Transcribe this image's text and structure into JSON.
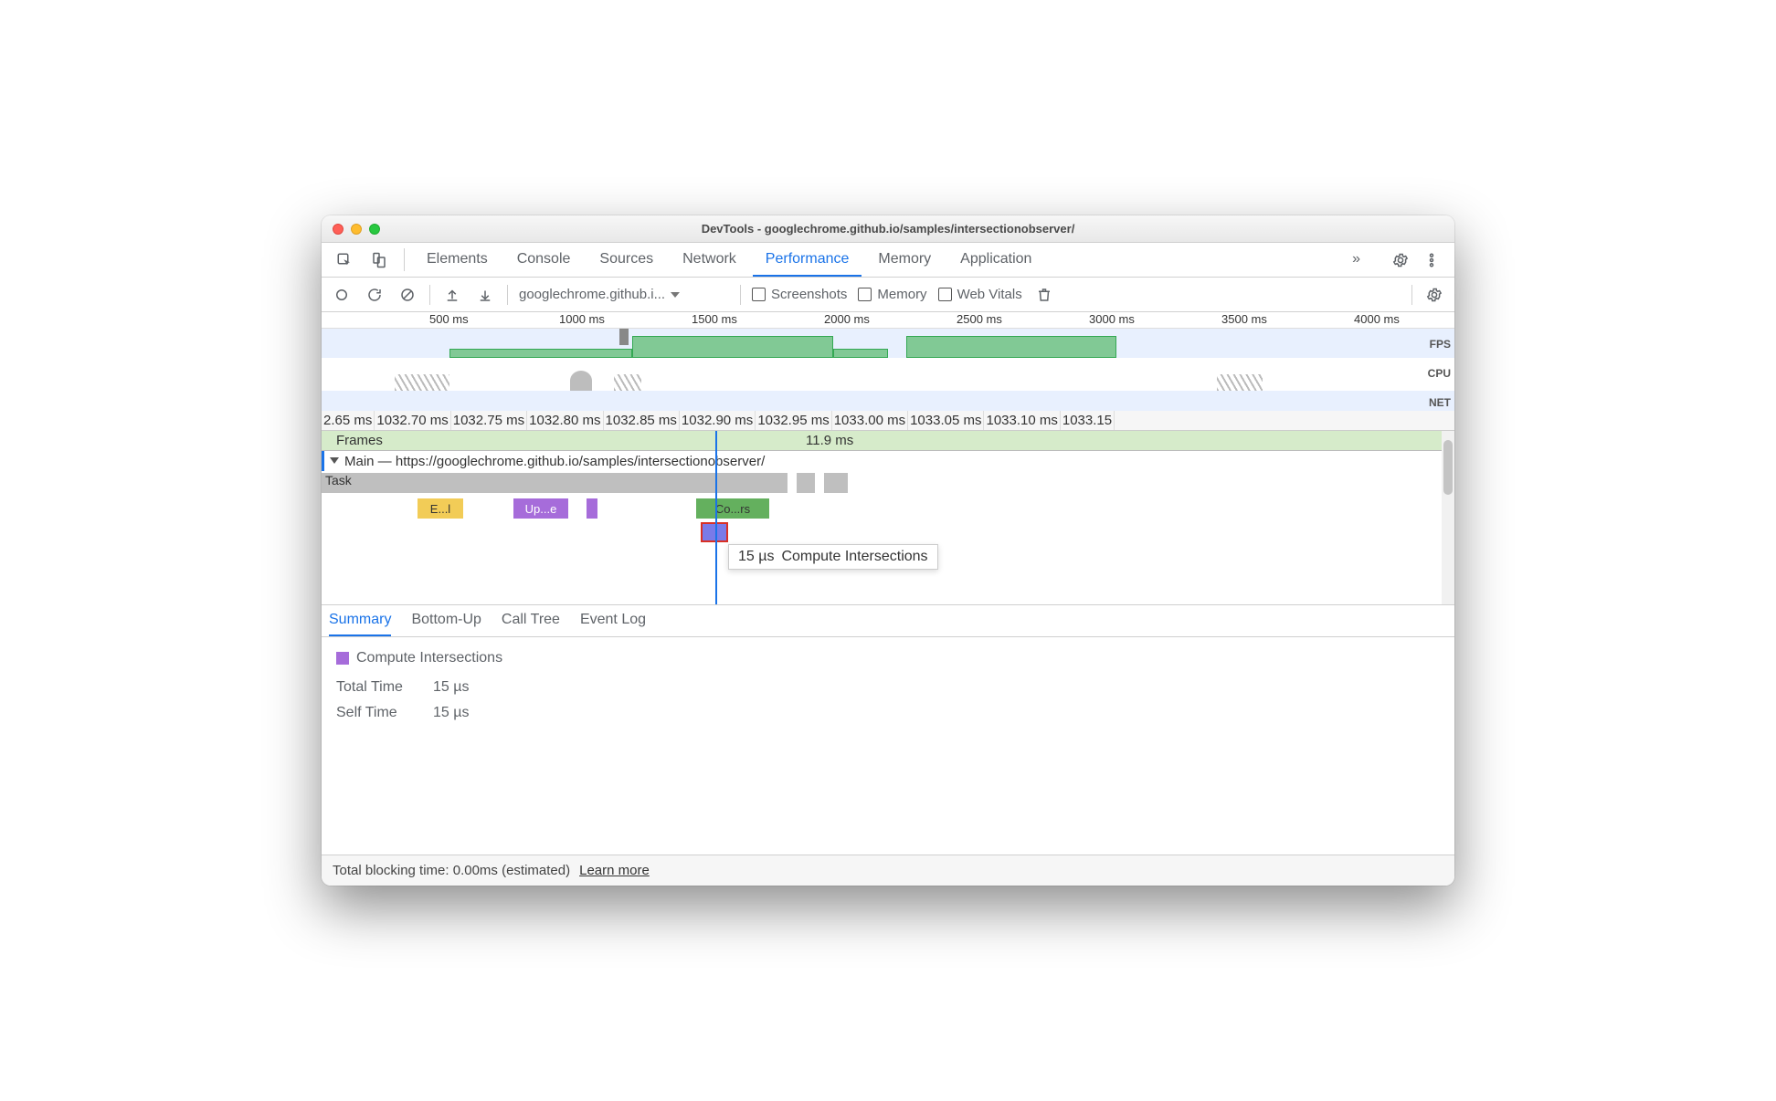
{
  "window": {
    "title": "DevTools - googlechrome.github.io/samples/intersectionobserver/"
  },
  "tabs": {
    "items": [
      "Elements",
      "Console",
      "Sources",
      "Network",
      "Performance",
      "Memory",
      "Application"
    ],
    "active": "Performance",
    "overflow_glyph": "»"
  },
  "toolbar": {
    "capture_label": "googlechrome.github.i...",
    "screenshots": "Screenshots",
    "memory": "Memory",
    "web_vitals": "Web Vitals"
  },
  "overview": {
    "ruler": [
      "500 ms",
      "1000 ms",
      "1500 ms",
      "2000 ms",
      "2500 ms",
      "3000 ms",
      "3500 ms",
      "4000 ms"
    ],
    "lanes": [
      "FPS",
      "CPU",
      "NET"
    ]
  },
  "flame": {
    "ruler2": [
      "2.65 ms",
      "1032.70 ms",
      "1032.75 ms",
      "1032.80 ms",
      "1032.85 ms",
      "1032.90 ms",
      "1032.95 ms",
      "1033.00 ms",
      "1033.05 ms",
      "1033.10 ms",
      "1033.15"
    ],
    "frames_label": "Frames",
    "frames_value": "11.9 ms",
    "main_label": "Main — https://googlechrome.github.io/samples/intersectionobserver/",
    "task_label": "Task",
    "ev_yellow": "E...l",
    "ev_purple": "Up...e",
    "ev_green": "Co...rs",
    "tooltip_time": "15 µs",
    "tooltip_name": "Compute Intersections"
  },
  "btabs": [
    "Summary",
    "Bottom-Up",
    "Call Tree",
    "Event Log"
  ],
  "summary": {
    "name": "Compute Intersections",
    "total_k": "Total Time",
    "total_v": "15 µs",
    "self_k": "Self Time",
    "self_v": "15 µs"
  },
  "footer": {
    "text": "Total blocking time: 0.00ms (estimated)",
    "link": "Learn more"
  }
}
